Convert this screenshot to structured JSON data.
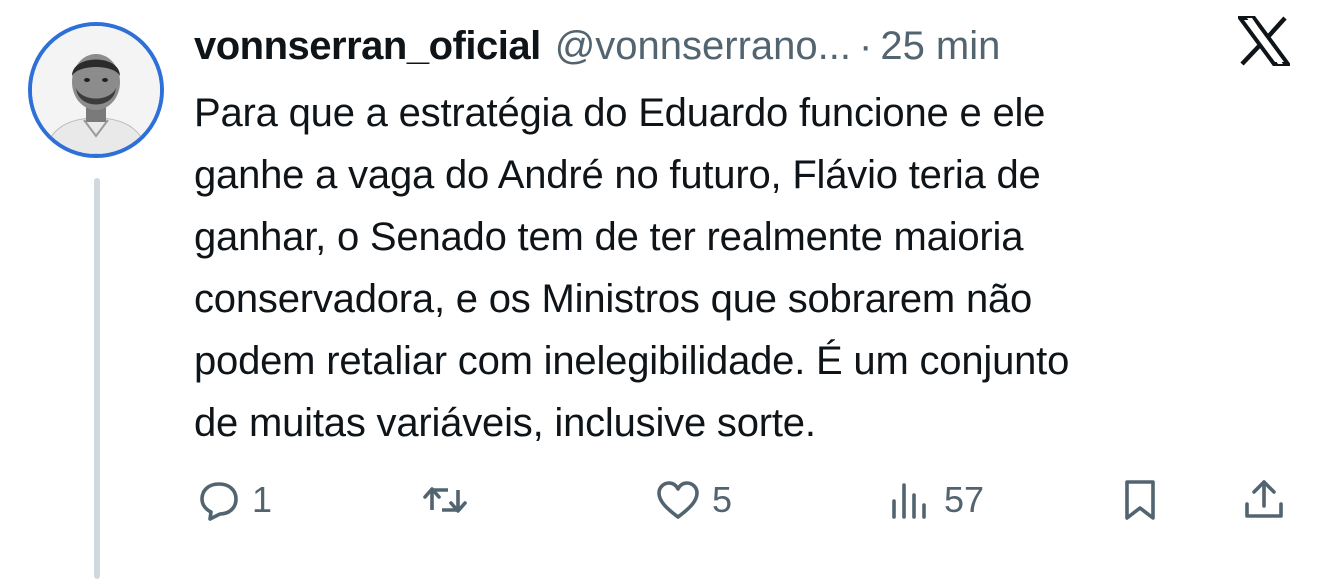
{
  "tweet": {
    "display_name": "vonnserran_oficial",
    "handle": "@vonnserrano...",
    "separator": "·",
    "time": "25 min",
    "platform_icon": "x-logo-icon",
    "text": "Para que a estratégia do Eduardo funcione e ele\nganhe a vaga do André no futuro, Flávio teria de\nganhar, o Senado tem de ter realmente maioria\nconservadora, e os Ministros que sobrarem não\npodem retaliar com inelegibilidade. É um conjunto\nde muitas variáveis, inclusive sorte.",
    "avatar_border_color": "#2f6fd8"
  },
  "actions": {
    "reply": {
      "icon": "reply-icon",
      "count": "1"
    },
    "retweet": {
      "icon": "retweet-icon",
      "count": ""
    },
    "like": {
      "icon": "heart-icon",
      "count": "5"
    },
    "views": {
      "icon": "views-icon",
      "count": "57"
    },
    "bookmark": {
      "icon": "bookmark-icon"
    },
    "share": {
      "icon": "share-icon"
    }
  },
  "colors": {
    "text_primary": "#0f1419",
    "text_secondary": "#536471",
    "thread_line": "#cfd9de"
  }
}
